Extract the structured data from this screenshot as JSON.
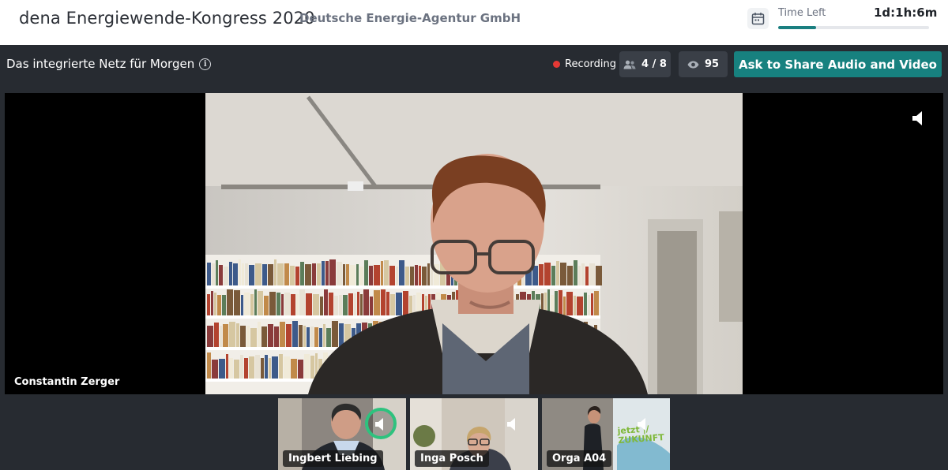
{
  "header": {
    "event_title": "dena Energiewende-Kongress 2020",
    "organizer": "Deutsche Energie-Agentur GmbH",
    "time_left_label": "Time Left",
    "time_left_value": "1d:1h:6m",
    "time_progress_percent": 25,
    "calendar_icon": "calendar-icon"
  },
  "session": {
    "title": "Das integrierte Netz für Morgen",
    "info_icon_glyph": "i",
    "recording_label": "Recording",
    "participants": "4 / 8",
    "viewers": "95",
    "share_button_label": "Ask to Share Audio and Video"
  },
  "main_video": {
    "speaker_name": "Constantin Zerger",
    "speaker_icon": "speaker-icon"
  },
  "thumbnails": [
    {
      "name": "Ingbert Liebing",
      "speaking": true
    },
    {
      "name": "Inga Posch",
      "speaking": false
    },
    {
      "name": "Orga A04",
      "speaking": false
    }
  ],
  "thumbnail_banner_text": "jetzt |/ ZUKUNFT",
  "colors": {
    "accent": "#17817f",
    "recording": "#e53935",
    "speaking": "#2ec27e",
    "background": "#272b31"
  }
}
